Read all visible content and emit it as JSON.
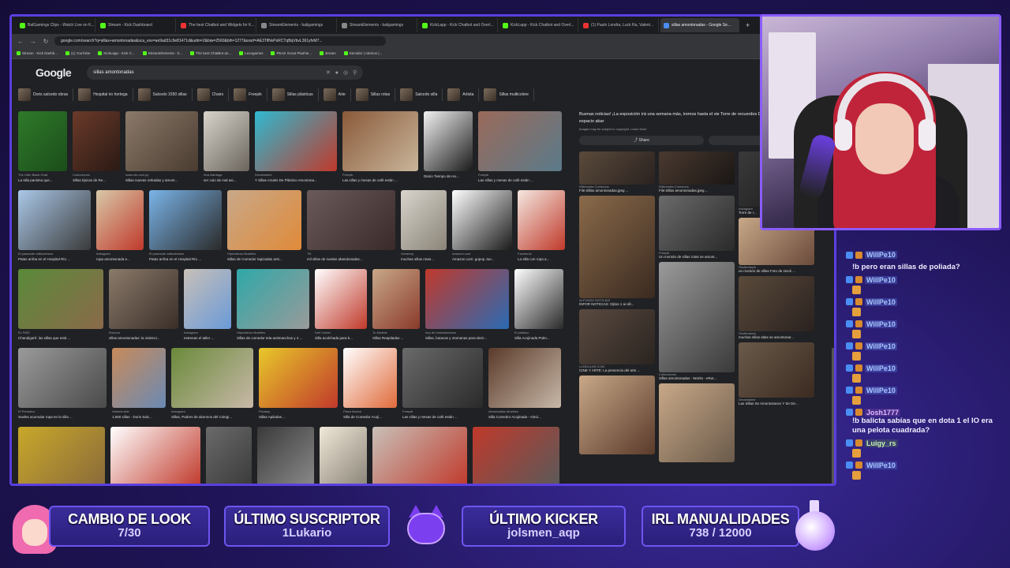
{
  "browser": {
    "tabs": [
      {
        "label": "BalGamings Clips - Watch Live on K...",
        "fav": "kick"
      },
      {
        "label": "Stream - Kick Dashboard",
        "fav": "kick"
      },
      {
        "label": "The best Chatbot and Widgets for K...",
        "fav": "red"
      },
      {
        "label": "StreamElements - baligamings",
        "fav": "grey"
      },
      {
        "label": "StreamElements - baligamings",
        "fav": "grey"
      },
      {
        "label": "KickLapp - Kick Chatbot and Overl...",
        "fav": "kick"
      },
      {
        "label": "KickLapp - Kick Chatbot and Overl...",
        "fav": "kick"
      },
      {
        "label": "(1) Paulo Londra, Luck Ra, Valent...",
        "fav": "red"
      },
      {
        "label": "sillas amontonadas - Google Se...",
        "fav": "blue",
        "active": true
      }
    ],
    "url": "google.com/search?q=sillas+amontonadas&sca_esv=ae9ad31c9e81471d&udm=2&biw=2560&bih=1277&sxsrf=AE3TifNvPsRCTqBqVbvL361yfvM7...",
    "bookmarks": [
      "Stream - Kick Dashb...",
      "(1) YouTube",
      "KickLapp - Kick C...",
      "StreamElements - b...",
      "The best ChatBot an...",
      "Lexogames",
      "PEAK Scout Plushie...",
      "stream",
      "Servidor | Atemos |..."
    ]
  },
  "google": {
    "logo": "Google",
    "query": "sillas amontonadas",
    "chips": [
      "Doris salcedo obras",
      "Hospital rio hortega",
      "Salcedo 1550 sillas",
      "Chairs",
      "Freepik",
      "Sillas plásticas",
      "Arte",
      "Sillas rotas",
      "Salcedo silla",
      "Artista",
      "Sillas multicolore"
    ],
    "rows": [
      [
        {
          "src": "The Little Black Goat",
          "cap": "La silla parisina que...",
          "w": 62,
          "c": "#2f7a2a,#1b4d1a"
        },
        {
          "src": "Colecciones",
          "cap": "Sillas típicas de Re...",
          "w": 60,
          "c": "#6b3a2a,#2a1a14"
        },
        {
          "src": "www.rdn.com.py",
          "cap": "Sillas nuevas retiradas y amont...",
          "w": 92,
          "c": "#8b7a6a,#4a3b30"
        },
        {
          "src": "Ana Bárdaga",
          "cap": "ser culo de mal asi...",
          "w": 58,
          "c": "#d8d4cc,#6a645c"
        },
        {
          "src": "Dreamstime",
          "cap": "Y Sillas Azules De Plástico Amontona...",
          "w": 104,
          "c": "#2fb9d0,#c0392b"
        },
        {
          "src": "Freepik",
          "cap": "Las sillas y mesas de café están ...",
          "w": 96,
          "c": "#8a5a3a,#c9b59a"
        },
        {
          "src": "",
          "cap": "Diario Tiempo de Ho...",
          "w": 62,
          "c": "#f2f2f2,#1a1a1a"
        },
        {
          "src": "Freepik",
          "cap": "Las sillas y mesas de café están ...",
          "w": 106,
          "c": "#9a6a5a,#5a7a8a"
        }
      ],
      [
        {
          "src": "El paseante vallisoletano",
          "cap": "Patas arriba en el Hospital Río ...",
          "w": 92,
          "c": "#aac8e8,#3a3a3a"
        },
        {
          "src": "Instagram",
          "cap": "ropa amontonada e...",
          "w": 60,
          "c": "#d8c8a8,#c0392b"
        },
        {
          "src": "El paseante vallisoletano",
          "cap": "Patas arriba en el Hospital Río ...",
          "w": 92,
          "c": "#7ab4e8,#2a2a2a"
        },
        {
          "src": "Hipnotismo Muebles",
          "cap": "Sillas de Comedor tapizadas anti...",
          "w": 94,
          "c": "#c8a888,#e08a3a"
        },
        {
          "src": "TN",
          "cap": "mil sillas de ruedas abandonadas...",
          "w": 112,
          "c": "#6a5a5a,#3a2a2a"
        },
        {
          "src": "Vecteezy",
          "cap": "muchas sillas rotas...",
          "w": 58,
          "c": "#d8d4cc,#8a8478"
        },
        {
          "src": "Amazon.com",
          "cap": "Amazon.com: gopop Jue...",
          "w": 76,
          "c": "#ffffff,#1a1a1a"
        },
        {
          "src": "Facebook",
          "cap": "La silla con ropa a...",
          "w": 60,
          "c": "#f4e8e0,#c0392b"
        }
      ],
      [
        {
          "src": "EL PAÍS",
          "cap": "Chandigarh: las sillas que está ...",
          "w": 108,
          "c": "#5a8a3a,#8a6a4a"
        },
        {
          "src": "Rodoca",
          "cap": "sillas amontonadas: la violenci...",
          "w": 88,
          "c": "#8a7a6a,#3a2e28"
        },
        {
          "src": "Instagram",
          "cap": "estrenan el taller ...",
          "w": 60,
          "c": "#c8c0b8,#6a9ad8"
        },
        {
          "src": "Hipnotismo Muebles",
          "cap": "Sillas de comedor tela antimanchas y 4 ...",
          "w": 92,
          "c": "#2fa8a8,#9a9a9a"
        },
        {
          "src": "Deli Center",
          "cap": "Silla acolchada para b...",
          "w": 66,
          "c": "#ffffff,#c0392b"
        },
        {
          "src": "Tu Mueble",
          "cap": "Sillas Reapiladas ...",
          "w": 60,
          "c": "#c8a888,#8a3a2a"
        },
        {
          "src": "Imp de Inmediaciones",
          "cap": "Sillas, butacas y otomanas para decir...",
          "w": 106,
          "c": "#c0392b,#2a6ab4"
        },
        {
          "src": "El plástico",
          "cap": "Silla Acojinada Pulm...",
          "w": 62,
          "c": "#ffffff,#2a2a2a"
        }
      ],
      [
        {
          "src": "El Periódico",
          "cap": "Sueles acumular ropa en la silla ...",
          "w": 112,
          "c": "#9a9a9a,#4a4a4a"
        },
        {
          "src": "Historia Arte",
          "cap": "1.550 sillas - Doris Salc...",
          "w": 68,
          "c": "#c88a5a,#6a8ab4"
        },
        {
          "src": "Instagram",
          "cap": "Sillas, Padres de alumnos del Colegi...",
          "w": 104,
          "c": "#6a8a3a,#c8b8a8"
        },
        {
          "src": "Pixabay",
          "cap": "Sillas Apiladas ...",
          "w": 100,
          "c": "#e8c82a,#c0392b"
        },
        {
          "src": "Plaza Mueve",
          "cap": "Silla de Comedor Acoji...",
          "w": 68,
          "c": "#ffffff,#e06a3a"
        },
        {
          "src": "Freepik",
          "cap": "Las sillas y mesas de café están ...",
          "w": 102,
          "c": "#6a6a6a,#2a2a2a"
        },
        {
          "src": "Almohadilas Muebles",
          "cap": "Silla Comedor Acojinada - Almó...",
          "w": 92,
          "c": "#5a3a2a,#c8b8a8"
        }
      ],
      [
        {
          "src": "",
          "cap": "",
          "w": 110,
          "c": "#c8a82a,#8a6a3a"
        },
        {
          "src": "",
          "cap": "",
          "w": 114,
          "c": "#ffffff,#c0392b"
        },
        {
          "src": "",
          "cap": "",
          "w": 58,
          "c": "#6a6a6a,#3a3a3a"
        },
        {
          "src": "",
          "cap": "",
          "w": 72,
          "c": "#3a3a3a,#8a8a8a"
        },
        {
          "src": "",
          "cap": "",
          "w": 60,
          "c": "#f0e8d8,#8a8478"
        },
        {
          "src": "",
          "cap": "",
          "w": 120,
          "c": "#c8c0b8,#c0392b"
        },
        {
          "src": "",
          "cap": "",
          "w": 110,
          "c": "#c0392b,#5a5a5a"
        }
      ]
    ],
    "side_text": "Buenas noticias! ¡La exposición irá una semana más, iremos hasta el vie Torre de recuerdos Decenas de sillas amontonadas en un espacio abar",
    "side_small": "Images may be subject to copyright. Learn More",
    "share_label": "Share",
    "save_label": "Sa",
    "side_cols": [
      [
        {
          "src": "Wikimedia Commons",
          "cap": "File:Sillas amontonadas.jpeg ...",
          "h": 42,
          "c": "#5a4a3a,#2a2220"
        },
        {
          "src": "ALFONSO NOTICIAS",
          "cap": "INFOR NOTICIAS: Ojitos 1 ai sill...",
          "h": 130,
          "c": "#8a6a4a,#3a2a20"
        },
        {
          "src": "LUNDULAR.COM",
          "cap": "CINE Y ARTE: La presencia del arte ...",
          "h": 70,
          "c": "#5a4a40,#2a2420"
        },
        {
          "src": "",
          "cap": "",
          "h": 100,
          "c": "#c8a888,#5a3a2a"
        }
      ],
      [
        {
          "src": "Wikimedia Commons",
          "cap": "File:Sillas amontonadas.jpeg ...",
          "h": 42,
          "c": "#4a3a30,#1a1614"
        },
        {
          "src": "Freepik",
          "cap": "Un montón de sillas rotas se amont...",
          "h": 70,
          "c": "#6a6a6a,#2a2a2a"
        },
        {
          "src": "Colecciones",
          "cap": "Sillas amontonadas - Works - eRut...",
          "h": 140,
          "c": "#9a9a9a,#3a3a3a"
        },
        {
          "src": "",
          "cap": "",
          "h": 100,
          "c": "#c8a888,#6a5a4a"
        }
      ],
      [
        {
          "src": "Instagram",
          "cap": "Torre de r...",
          "h": 70,
          "c": "#3a3a3a,#1a1a1a"
        },
        {
          "src": "Shutterstock",
          "cap": "un montón de sillas Foto de stock ...",
          "h": 60,
          "c": "#c8a888,#6a4a3a"
        },
        {
          "src": "Shutterstock",
          "cap": "muchas sillas altas se amontonar...",
          "h": 70,
          "c": "#5a4a3a,#2a2220"
        },
        {
          "src": "Dreamstime",
          "cap": "Las Sillas Se Amontonaron Y Se De...",
          "h": 70,
          "c": "#6a5a4a,#3a2a20"
        }
      ]
    ]
  },
  "chat": [
    {
      "user": "WillPe10",
      "style": "blue",
      "text": "",
      "emote": false
    },
    {
      "user": "",
      "style": "blue",
      "text": "!b pero eran sillas de poliada?",
      "emote": false
    },
    {
      "user": "WillPe10",
      "style": "blue",
      "text": "",
      "emote": true
    },
    {
      "user": "WillPe10",
      "style": "blue",
      "text": "",
      "emote": true
    },
    {
      "user": "WillPe10",
      "style": "blue",
      "text": "",
      "emote": true
    },
    {
      "user": "WillPe10",
      "style": "blue",
      "text": "",
      "emote": true
    },
    {
      "user": "WillPe10",
      "style": "blue",
      "text": "",
      "emote": true
    },
    {
      "user": "WillPe10",
      "style": "blue",
      "text": "",
      "emote": true
    },
    {
      "user": "Josh1777",
      "style": "pink",
      "text": "!b balicta sabías que en dota 1 el IO era una pelota cuadrada?",
      "emote": false
    },
    {
      "user": "Luigy_rs",
      "style": "green",
      "text": "",
      "emote": true
    },
    {
      "user": "WillPe10",
      "style": "blue",
      "text": "",
      "emote": true
    }
  ],
  "panels": {
    "look": {
      "title": "CAMBIO DE LOOK",
      "value": "7/30"
    },
    "sub": {
      "title": "ÚLTIMO SUSCRIPTOR",
      "value": "1Lukario"
    },
    "kicker": {
      "title": "ÚLTIMO KICKER",
      "value": "jolsmen_aqp"
    },
    "irl": {
      "title": "IRL MANUALIDADES",
      "value": "738 / 12000"
    }
  }
}
